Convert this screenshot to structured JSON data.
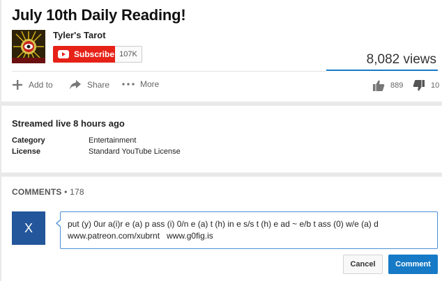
{
  "video": {
    "title": "July 10th Daily Reading!",
    "channel_name": "Tyler's Tarot",
    "subscribe_label": "Subscribe",
    "subscriber_count": "107K",
    "views": "8,082 views",
    "actions": {
      "add_to": "Add to",
      "share": "Share",
      "more": "More",
      "likes": "889",
      "dislikes": "10"
    }
  },
  "details": {
    "streamed": "Streamed live 8 hours ago",
    "category_label": "Category",
    "category_value": "Entertainment",
    "license_label": "License",
    "license_value": "Standard YouTube License"
  },
  "comments": {
    "heading": "COMMENTS",
    "count": "• 178",
    "avatar_letter": "X",
    "draft_text": "put (y) 0ur a(i)r e (a) p ass (i) 0/n e (a) t (h) in e s/s t (h) e ad ~ e/b t ass (0) w/e (a) d\nwww.patreon.com/xubrnt   www.g0fig.is",
    "cancel_label": "Cancel",
    "comment_label": "Comment"
  },
  "colors": {
    "subscribe_red": "#e62117",
    "accent_blue": "#167ac6",
    "avatar_blue": "#23569a"
  }
}
